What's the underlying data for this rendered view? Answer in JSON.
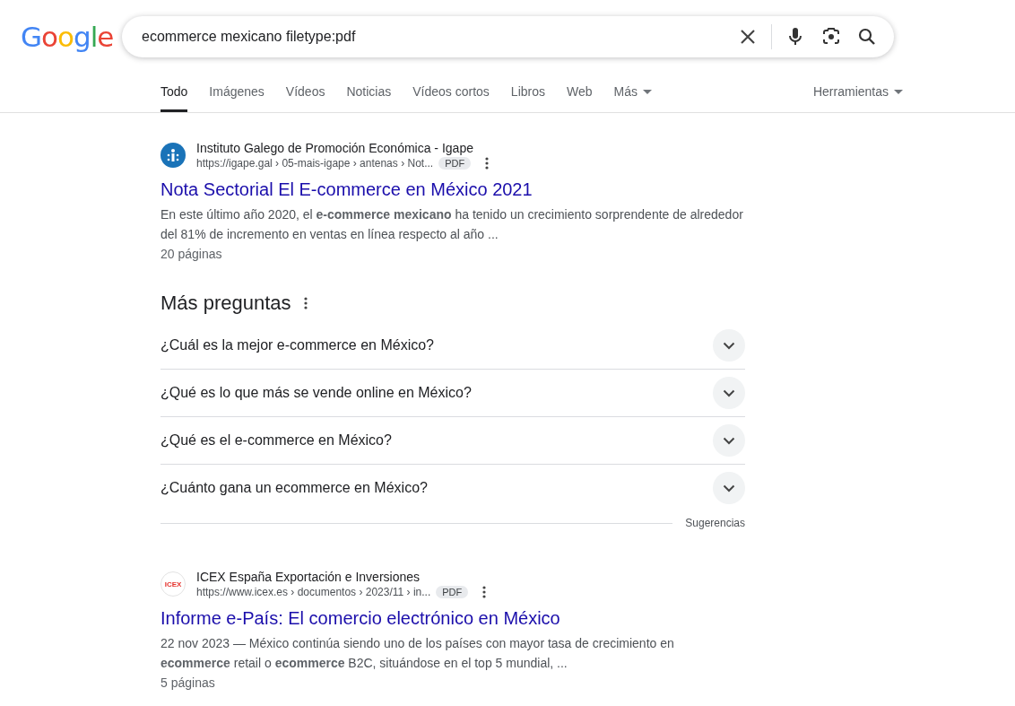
{
  "logo": "Google",
  "search": {
    "value": "ecommerce mexicano filetype:pdf"
  },
  "tabs": [
    {
      "label": "Todo",
      "selected": true,
      "dropdown": false
    },
    {
      "label": "Imágenes",
      "selected": false,
      "dropdown": false
    },
    {
      "label": "Vídeos",
      "selected": false,
      "dropdown": false
    },
    {
      "label": "Noticias",
      "selected": false,
      "dropdown": false
    },
    {
      "label": "Vídeos cortos",
      "selected": false,
      "dropdown": false
    },
    {
      "label": "Libros",
      "selected": false,
      "dropdown": false
    },
    {
      "label": "Web",
      "selected": false,
      "dropdown": false
    },
    {
      "label": "Más",
      "selected": false,
      "dropdown": true
    }
  ],
  "tools": "Herramientas",
  "results_top": [
    {
      "site": "Instituto Galego de Promoción Económica - Igape",
      "url": "https://igape.gal › 05-mais-igape › antenas › Not...",
      "badge": "PDF",
      "title": "Nota Sectorial El E-commerce en México 2021",
      "snippet": "En este último año 2020, el **e-commerce mexicano** ha tenido un crecimiento sorprendente de alrededor del 81% de incremento en ventas en línea respecto al año ...",
      "pages": "20 páginas"
    }
  ],
  "questions": {
    "title": "Más preguntas",
    "items": [
      {
        "text": "¿Cuál es la mejor e-commerce en México?",
        "expanded": false
      },
      {
        "text": "¿Qué es lo que más se vende online en México?",
        "expanded": false
      },
      {
        "text": "¿Qué es el e-commerce en México?",
        "expanded": false
      },
      {
        "text": "¿Cuánto gana un ecommerce en México?",
        "expanded": false
      }
    ],
    "footer": "Sugerencias"
  },
  "results_bottom": [
    {
      "site": "ICEX España Exportación e Inversiones",
      "favicon_text": "ICEX",
      "url": "https://www.icex.es › documentos › 2023/11 › in...",
      "badge": "PDF",
      "title": "Informe e-País: El comercio electrónico en México",
      "snippet": "22 nov 2023 — México continúa siendo uno de los países con mayor tasa de crecimiento en **ecommerce** retail o **ecommerce** B2C, situándose en el top 5 mundial, ...",
      "pages": "5 páginas"
    }
  ]
}
